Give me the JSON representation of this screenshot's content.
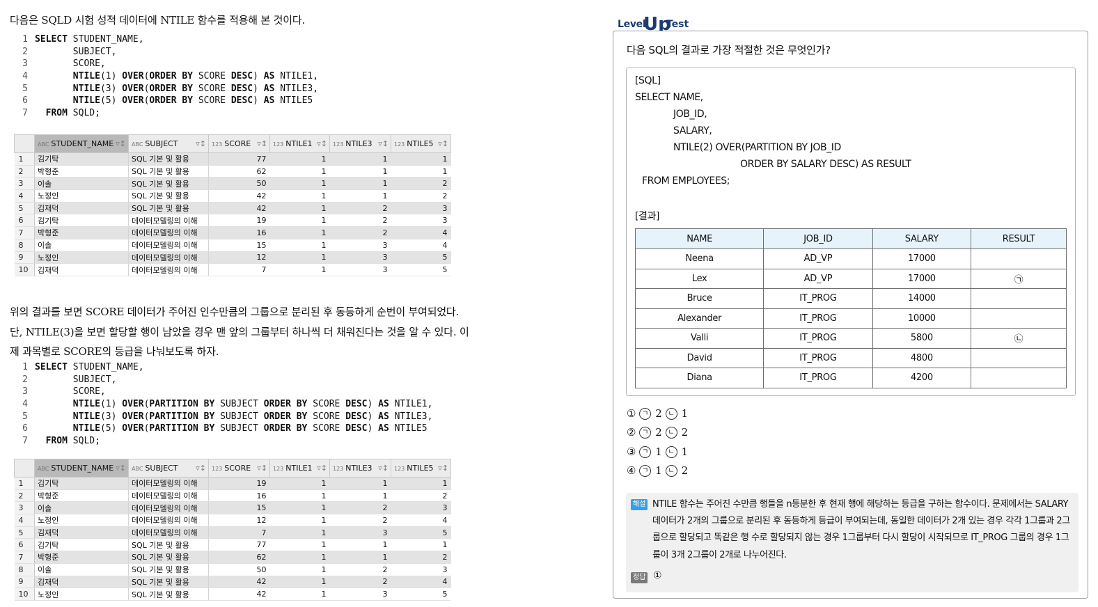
{
  "left": {
    "intro": "다음은 SQLD 시험 성적 데이터에 NTILE 함수를 적용해 본 것이다.",
    "code1": [
      [
        {
          "t": "SELECT",
          "k": true
        },
        {
          "t": " STUDENT_NAME,"
        }
      ],
      [
        {
          "t": "       SUBJECT,"
        }
      ],
      [
        {
          "t": "       SCORE,"
        }
      ],
      [
        {
          "t": "       "
        },
        {
          "t": "NTILE",
          "k": true
        },
        {
          "t": "(1) "
        },
        {
          "t": "OVER",
          "k": true
        },
        {
          "t": "("
        },
        {
          "t": "ORDER BY",
          "k": true
        },
        {
          "t": " SCORE "
        },
        {
          "t": "DESC",
          "k": true
        },
        {
          "t": ") "
        },
        {
          "t": "AS",
          "k": true
        },
        {
          "t": " NTILE1,"
        }
      ],
      [
        {
          "t": "       "
        },
        {
          "t": "NTILE",
          "k": true
        },
        {
          "t": "(3) "
        },
        {
          "t": "OVER",
          "k": true
        },
        {
          "t": "("
        },
        {
          "t": "ORDER BY",
          "k": true
        },
        {
          "t": " SCORE "
        },
        {
          "t": "DESC",
          "k": true
        },
        {
          "t": ") "
        },
        {
          "t": "AS",
          "k": true
        },
        {
          "t": " NTILE3,"
        }
      ],
      [
        {
          "t": "       "
        },
        {
          "t": "NTILE",
          "k": true
        },
        {
          "t": "(5) "
        },
        {
          "t": "OVER",
          "k": true
        },
        {
          "t": "("
        },
        {
          "t": "ORDER BY",
          "k": true
        },
        {
          "t": " SCORE "
        },
        {
          "t": "DESC",
          "k": true
        },
        {
          "t": ") "
        },
        {
          "t": "AS",
          "k": true
        },
        {
          "t": " NTILE5"
        }
      ],
      [
        {
          "t": "  "
        },
        {
          "t": "FROM",
          "k": true
        },
        {
          "t": " SQLD;"
        }
      ]
    ],
    "grid_headers": [
      {
        "type": "ABC",
        "name": "STUDENT_NAME"
      },
      {
        "type": "ABC",
        "name": "SUBJECT"
      },
      {
        "type": "123",
        "name": "SCORE"
      },
      {
        "type": "123",
        "name": "NTILE1"
      },
      {
        "type": "123",
        "name": "NTILE3"
      },
      {
        "type": "123",
        "name": "NTILE5"
      }
    ],
    "grid1_rows": [
      [
        "1",
        "김기탁",
        "SQL 기본 및 활용",
        "77",
        "1",
        "1",
        "1"
      ],
      [
        "2",
        "박형준",
        "SQL 기본 및 활용",
        "62",
        "1",
        "1",
        "1"
      ],
      [
        "3",
        "이솔",
        "SQL 기본 및 활용",
        "50",
        "1",
        "1",
        "2"
      ],
      [
        "4",
        "노정인",
        "SQL 기본 및 활용",
        "42",
        "1",
        "1",
        "2"
      ],
      [
        "5",
        "김재덕",
        "SQL 기본 및 활용",
        "42",
        "1",
        "2",
        "3"
      ],
      [
        "6",
        "김기탁",
        "데이터모델링의 이해",
        "19",
        "1",
        "2",
        "3"
      ],
      [
        "7",
        "박형준",
        "데이터모델링의 이해",
        "16",
        "1",
        "2",
        "4"
      ],
      [
        "8",
        "이솔",
        "데이터모델링의 이해",
        "15",
        "1",
        "3",
        "4"
      ],
      [
        "9",
        "노정인",
        "데이터모델링의 이해",
        "12",
        "1",
        "3",
        "5"
      ],
      [
        "10",
        "김재덕",
        "데이터모델링의 이해",
        "7",
        "1",
        "3",
        "5"
      ]
    ],
    "para2": "위의 결과를 보면 SCORE 데이터가 주어진 인수만큼의 그룹으로 분리된 후 동등하게 순번이 부여되었다. 단, NTILE(3)을 보면 할당할 행이 남았을 경우 맨 앞의 그룹부터 하나씩 더 채워진다는 것을 알 수 있다. 이제 과목별로 SCORE의 등급을 나눠보도록 하자.",
    "code2": [
      [
        {
          "t": "SELECT",
          "k": true
        },
        {
          "t": " STUDENT_NAME,"
        }
      ],
      [
        {
          "t": "       SUBJECT,"
        }
      ],
      [
        {
          "t": "       SCORE,"
        }
      ],
      [
        {
          "t": "       "
        },
        {
          "t": "NTILE",
          "k": true
        },
        {
          "t": "(1) "
        },
        {
          "t": "OVER",
          "k": true
        },
        {
          "t": "("
        },
        {
          "t": "PARTITION BY",
          "k": true
        },
        {
          "t": " SUBJECT "
        },
        {
          "t": "ORDER BY",
          "k": true
        },
        {
          "t": " SCORE "
        },
        {
          "t": "DESC",
          "k": true
        },
        {
          "t": ") "
        },
        {
          "t": "AS",
          "k": true
        },
        {
          "t": " NTILE1,"
        }
      ],
      [
        {
          "t": "       "
        },
        {
          "t": "NTILE",
          "k": true
        },
        {
          "t": "(3) "
        },
        {
          "t": "OVER",
          "k": true
        },
        {
          "t": "("
        },
        {
          "t": "PARTITION BY",
          "k": true
        },
        {
          "t": " SUBJECT "
        },
        {
          "t": "ORDER BY",
          "k": true
        },
        {
          "t": " SCORE "
        },
        {
          "t": "DESC",
          "k": true
        },
        {
          "t": ") "
        },
        {
          "t": "AS",
          "k": true
        },
        {
          "t": " NTILE3,"
        }
      ],
      [
        {
          "t": "       "
        },
        {
          "t": "NTILE",
          "k": true
        },
        {
          "t": "(5) "
        },
        {
          "t": "OVER",
          "k": true
        },
        {
          "t": "("
        },
        {
          "t": "PARTITION BY",
          "k": true
        },
        {
          "t": " SUBJECT "
        },
        {
          "t": "ORDER BY",
          "k": true
        },
        {
          "t": " SCORE "
        },
        {
          "t": "DESC",
          "k": true
        },
        {
          "t": ") "
        },
        {
          "t": "AS",
          "k": true
        },
        {
          "t": " NTILE5"
        }
      ],
      [
        {
          "t": "  "
        },
        {
          "t": "FROM",
          "k": true
        },
        {
          "t": " SQLD;"
        }
      ]
    ],
    "grid2_rows": [
      [
        "1",
        "김기탁",
        "데이터모델링의 이해",
        "19",
        "1",
        "1",
        "1"
      ],
      [
        "2",
        "박형준",
        "데이터모델링의 이해",
        "16",
        "1",
        "1",
        "2"
      ],
      [
        "3",
        "이솔",
        "데이터모델링의 이해",
        "15",
        "1",
        "2",
        "3"
      ],
      [
        "4",
        "노정인",
        "데이터모델링의 이해",
        "12",
        "1",
        "2",
        "4"
      ],
      [
        "5",
        "김재덕",
        "데이터모델링의 이해",
        "7",
        "1",
        "3",
        "5"
      ],
      [
        "6",
        "김기탁",
        "SQL 기본 및 활용",
        "77",
        "1",
        "1",
        "1"
      ],
      [
        "7",
        "박형준",
        "SQL 기본 및 활용",
        "62",
        "1",
        "1",
        "2"
      ],
      [
        "8",
        "이솔",
        "SQL 기본 및 활용",
        "50",
        "1",
        "2",
        "3"
      ],
      [
        "9",
        "김재덕",
        "SQL 기본 및 활용",
        "42",
        "1",
        "2",
        "4"
      ],
      [
        "10",
        "노정인",
        "SQL 기본 및 활용",
        "42",
        "1",
        "3",
        "5"
      ]
    ]
  },
  "right": {
    "logo": {
      "level": "Level",
      "up": "Up",
      "test": "Test",
      "color": "#1a3d6e"
    },
    "question": "다음 SQL의 결과로 가장 적절한 것은 무엇인가?",
    "sql_label": "[SQL]",
    "sql_lines": [
      "SELECT NAME,",
      "JOB_ID,",
      "SALARY,",
      "NTILE(2) OVER(PARTITION BY JOB_ID",
      "ORDER BY SALARY DESC) AS RESULT",
      "FROM EMPLOYEES;"
    ],
    "result_label": "[결과]",
    "result_headers": [
      "NAME",
      "JOB_ID",
      "SALARY",
      "RESULT"
    ],
    "result_rows": [
      [
        "Neena",
        "AD_VP",
        "17000",
        ""
      ],
      [
        "Lex",
        "AD_VP",
        "17000",
        "㉠"
      ],
      [
        "Bruce",
        "IT_PROG",
        "14000",
        ""
      ],
      [
        "Alexander",
        "IT_PROG",
        "10000",
        ""
      ],
      [
        "Valli",
        "IT_PROG",
        "5800",
        "㉡"
      ],
      [
        "David",
        "IT_PROG",
        "4800",
        ""
      ],
      [
        "Diana",
        "IT_PROG",
        "4200",
        ""
      ]
    ],
    "options": [
      {
        "no": "①",
        "a": "2",
        "b": "1"
      },
      {
        "no": "②",
        "a": "2",
        "b": "2"
      },
      {
        "no": "③",
        "a": "1",
        "b": "1"
      },
      {
        "no": "④",
        "a": "1",
        "b": "2"
      }
    ],
    "mark_a": "ㄱ",
    "mark_b": "ㄴ",
    "explain_badge": "해설",
    "explain_text": "NTILE 함수는 주어진 수만큼 행들을 n등분한 후 현재 행에 해당하는 등급을 구하는 함수이다. 문제에서는 SALARY 데이터가 2개의 그룹으로 분리된 후 동등하게 등급이 부여되는데, 동일한 데이터가 2개 있는 경우 각각 1그룹과 2그룹으로 할당되고 똑같은 행 수로 할당되지 않는 경우 1그룹부터 다시 할당이 시작되므로 IT_PROG 그룹의 경우 1그룹이 3개 2그룹이 2개로 나누어진다.",
    "answer_badge": "정답",
    "answer": "①"
  }
}
